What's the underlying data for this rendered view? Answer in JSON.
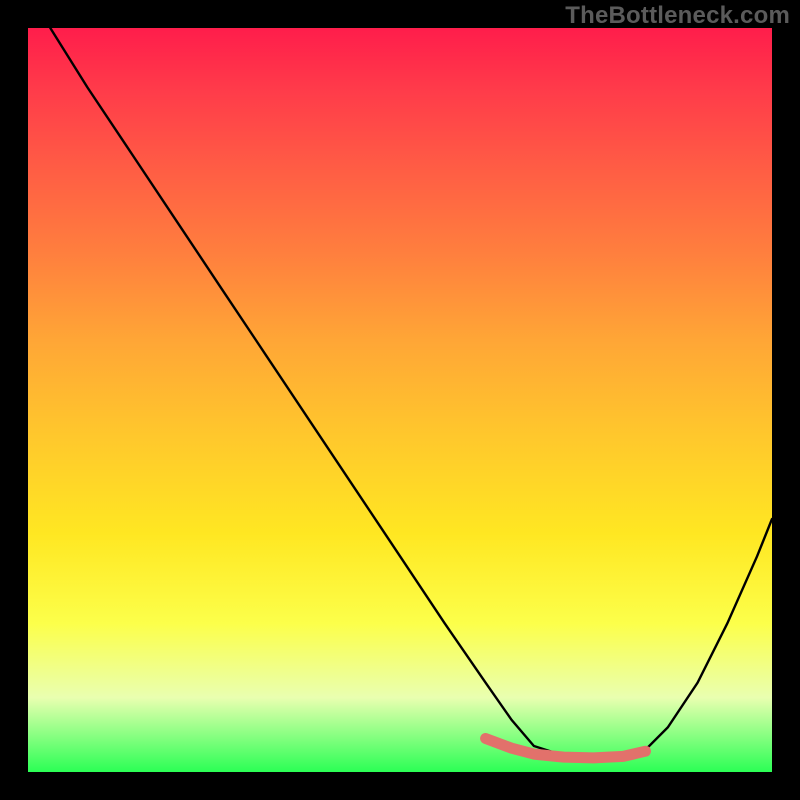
{
  "watermark": "TheBottleneck.com",
  "colors": {
    "page_bg": "#000000",
    "watermark": "#5b5b5b",
    "curve": "#000000",
    "floor_marker": "#e2716b",
    "gradient_stops": [
      "#ff1d4b",
      "#ff3a4a",
      "#ff5a45",
      "#ff7e3e",
      "#ffa636",
      "#ffc82c",
      "#ffe722",
      "#fcff4a",
      "#e9ffb0",
      "#2bff55"
    ]
  },
  "chart_data": {
    "type": "line",
    "title": "",
    "xlabel": "",
    "ylabel": "",
    "xlim": [
      0,
      100
    ],
    "ylim": [
      0,
      100
    ],
    "note": "Axes unlabeled; values are relative % estimates read from pixel positions. Y=0 at bottom (green), Y=100 at top (red). Curve resembles a bottleneck V with minimum plateau around x≈68–83.",
    "series": [
      {
        "name": "curve",
        "x": [
          3,
          8,
          14,
          20,
          26,
          32,
          38,
          44,
          50,
          56,
          61.5,
          65,
          68,
          72,
          76,
          80,
          83,
          86,
          90,
          94,
          98,
          100
        ],
        "y": [
          100,
          92,
          83,
          74,
          65,
          56,
          47,
          38,
          29,
          20,
          12,
          7,
          3.5,
          2.2,
          1.8,
          2.0,
          3.0,
          6,
          12,
          20,
          29,
          34
        ]
      }
    ],
    "floor_marker": {
      "note": "Short salmon segment hugging the curve's minimum plateau near the bottom.",
      "x": [
        61.5,
        65,
        68,
        72,
        76,
        80,
        83
      ],
      "y": [
        4.5,
        3.2,
        2.4,
        2.0,
        1.9,
        2.1,
        2.8
      ]
    }
  }
}
